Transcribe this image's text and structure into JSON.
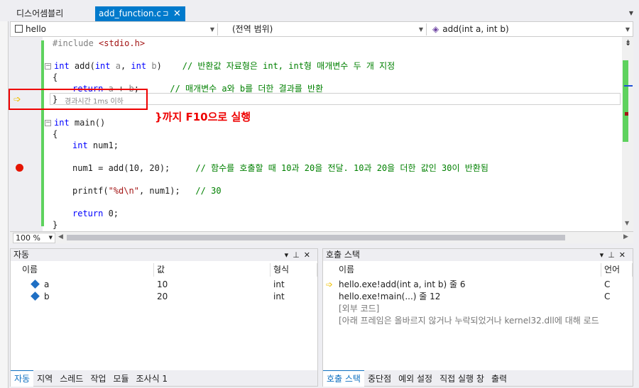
{
  "tabs": {
    "disassembly": "디스어셈블리",
    "active_file": "add_function.c",
    "pin_glyph": "⊐",
    "close_glyph": "✕"
  },
  "nav": {
    "project": "hello",
    "scope": "(전역 범위)",
    "member": "add(int a, int b)"
  },
  "code": {
    "include_kw": "#include",
    "include_file": "<stdio.h>",
    "add_sig": "int add(int a, int b)",
    "add_comment": "// 반환값 자료형은 int, int형 매개변수 두 개 지정",
    "open1": "{",
    "return_stmt": "return a + b;",
    "return_comment": "// 매개변수 a와 b를 더한 결과를 반환",
    "close1": "}",
    "elapsed": "경과시간 1ms 이하",
    "main_sig": "int main()",
    "open2": "{",
    "decl": "int num1;",
    "call": "num1 = add(10, 20);",
    "call_comment": "// 함수를 호출할 때 10과 20을 전달. 10과 20을 더한 값인 30이 반환됨",
    "printf_a": "printf(",
    "printf_str": "\"%d\\n\"",
    "printf_b": ", num1);",
    "printf_comment": "// 30",
    "ret0": "return 0;",
    "close2": "}"
  },
  "annotation": "}까지 F10으로 실행",
  "zoom": "100 %",
  "autos": {
    "title": "자동",
    "columns": [
      "이름",
      "값",
      "형식"
    ],
    "rows": [
      {
        "name": "a",
        "value": "10",
        "type": "int"
      },
      {
        "name": "b",
        "value": "20",
        "type": "int"
      }
    ],
    "tabs": [
      "자동",
      "지역",
      "스레드",
      "작업",
      "모듈",
      "조사식 1"
    ]
  },
  "callstack": {
    "title": "호출 스택",
    "columns": [
      "이름",
      "언어"
    ],
    "rows": [
      {
        "name": "hello.exe!add(int a, int b) 줄 6",
        "lang": "C"
      },
      {
        "name": "hello.exe!main(...) 줄 12",
        "lang": "C"
      },
      {
        "name": "[외부 코드]",
        "lang": ""
      },
      {
        "name": "[아래 프레임은 올바르지 않거나 누락되었거나 kernel32.dll에 대해 로드",
        "lang": ""
      }
    ],
    "tabs": [
      "호출 스택",
      "중단점",
      "예외 설정",
      "직접 실행 창",
      "출력"
    ]
  },
  "colors": {
    "accent": "#007acc",
    "breakpoint": "#e51400",
    "changed_bar": "#5ed25e",
    "annotation": "#e00000"
  }
}
